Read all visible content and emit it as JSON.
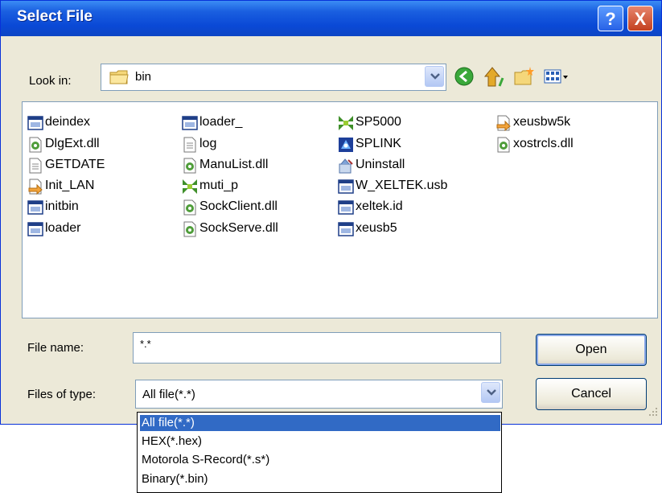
{
  "window": {
    "title": "Select File"
  },
  "titlebar_buttons": {
    "help": "?",
    "close": "X"
  },
  "look_in": {
    "label": "Look in:",
    "value": "bin"
  },
  "files": [
    {
      "name": "deindex",
      "icon": "window-app-icon"
    },
    {
      "name": "DlgExt.dll",
      "icon": "dll-icon"
    },
    {
      "name": "GETDATE",
      "icon": "text-file-icon"
    },
    {
      "name": "Init_LAN",
      "icon": "shortcut-icon"
    },
    {
      "name": "initbin",
      "icon": "window-app-icon"
    },
    {
      "name": "loader",
      "icon": "window-app-icon"
    },
    {
      "name": "loader_",
      "icon": "window-app-icon"
    },
    {
      "name": "log",
      "icon": "text-file-icon"
    },
    {
      "name": "ManuList.dll",
      "icon": "dll-icon"
    },
    {
      "name": "muti_p",
      "icon": "program-green-icon"
    },
    {
      "name": "SockClient.dll",
      "icon": "dll-icon"
    },
    {
      "name": "SockServe.dll",
      "icon": "dll-icon"
    },
    {
      "name": "SP5000",
      "icon": "program-green-icon"
    },
    {
      "name": "SPLINK",
      "icon": "program-blue-icon"
    },
    {
      "name": "Uninstall",
      "icon": "uninstall-icon"
    },
    {
      "name": "W_XELTEK.usb",
      "icon": "window-app-icon"
    },
    {
      "name": "xeltek.id",
      "icon": "window-app-icon"
    },
    {
      "name": "xeusb5",
      "icon": "window-app-icon"
    },
    {
      "name": "xeusbw5k",
      "icon": "shortcut-icon"
    },
    {
      "name": "xostrcls.dll",
      "icon": "dll-icon"
    }
  ],
  "file_name": {
    "label": "File name:",
    "value": "*.*"
  },
  "files_of_type": {
    "label": "Files of type:",
    "value": "All file(*.*)",
    "options": [
      "All file(*.*)",
      "HEX(*.hex)",
      "Motorola S-Record(*.s*)",
      "Binary(*.bin)"
    ]
  },
  "buttons": {
    "open": "Open",
    "cancel": "Cancel"
  },
  "colors": {
    "title_bar": "#0a49d6",
    "dialog_bg": "#ece9d8",
    "selection": "#316ac5"
  }
}
